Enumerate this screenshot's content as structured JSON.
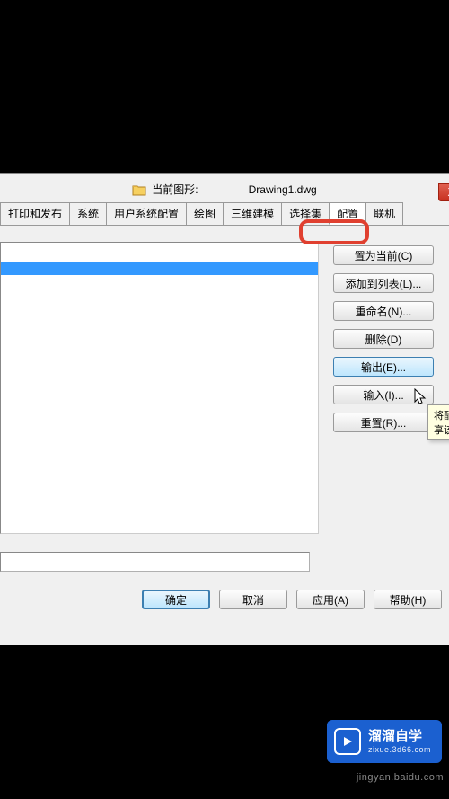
{
  "header": {
    "current_drawing_label": "当前图形:",
    "drawing_name": "Drawing1.dwg"
  },
  "tabs": [
    {
      "label": "打印和发布"
    },
    {
      "label": "系统"
    },
    {
      "label": "用户系统配置"
    },
    {
      "label": "绘图"
    },
    {
      "label": "三维建模"
    },
    {
      "label": "选择集"
    },
    {
      "label": "配置"
    },
    {
      "label": "联机"
    }
  ],
  "side_buttons": {
    "set_current": "置为当前(C)",
    "add_to_list": "添加到列表(L)...",
    "rename": "重命名(N)...",
    "delete": "删除(D)",
    "export": "输出(E)...",
    "import": "输入(I)...",
    "reset": "重置(R)..."
  },
  "tooltip": {
    "line1": "将配置",
    "line2": "享该文"
  },
  "bottom_buttons": {
    "ok": "确定",
    "cancel": "取消",
    "apply": "应用(A)",
    "help": "帮助(H)"
  },
  "brand": {
    "title": "溜溜自学",
    "sub": "zixue.3d66.com"
  },
  "watermark": "jingyan.baidu.com"
}
